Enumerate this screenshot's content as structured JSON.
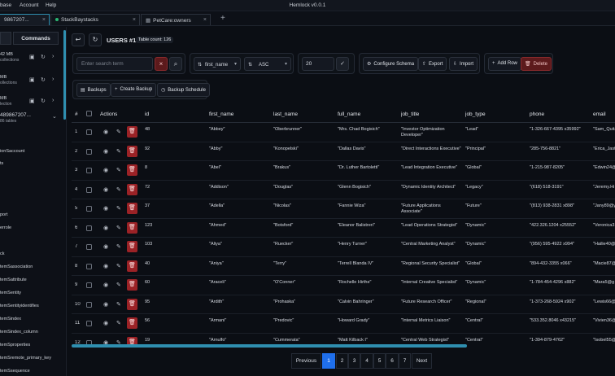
{
  "menubar": {
    "items": [
      "base",
      "Account",
      "Help"
    ],
    "title": "Hemlock v0.0.1"
  },
  "tabs": [
    {
      "label": "9867207..."
    },
    {
      "label": "StackBaystacks"
    },
    {
      "label": "PetCare:owners"
    }
  ],
  "sidebar": {
    "commands_label": "Commands",
    "connections": [
      {
        "size": "42 MB",
        "sub": "collections"
      },
      {
        "size": "MB",
        "sub": "ollections"
      },
      {
        "size": "MB",
        "sub": "lection"
      }
    ],
    "database": {
      "name": "489867207...",
      "sub": "86 tables"
    },
    "tables": [
      "ionSaccount",
      "ts",
      "",
      "",
      "",
      "port",
      "errole",
      "",
      "ck",
      "temSassociation",
      "temSattribute",
      "temSentity",
      "temSentityidentifies",
      "temSindex",
      "temSindex_column",
      "temSproperties",
      "temSremote_primary_key",
      "temSsequence"
    ]
  },
  "header": {
    "title": "USERS #1",
    "count": "Table count: 126"
  },
  "toolbar": {
    "search_placeholder": "Enter search term",
    "sort_field": "first_name",
    "sort_order": "ASC",
    "limit": "20",
    "schema_label": "Configure Schema",
    "export_label": "Export",
    "import_label": "Import",
    "add_row_label": "Add Row",
    "delete_label": "Delete"
  },
  "toolbar2": {
    "backups_label": "Backups",
    "create_backup_label": "Create Backup",
    "schedule_label": "Backup Schedule"
  },
  "table": {
    "columns": [
      "#",
      "Actions",
      "id",
      "first_name",
      "last_name",
      "full_name",
      "job_title",
      "job_type",
      "phone",
      "email"
    ],
    "rows": [
      [
        "1",
        "48",
        "\"Abbey\"",
        "\"Oberbrunner\"",
        "\"Mrs. Chad Bogisich\"",
        "\"Investor Optimization Developer\"",
        "\"Lead\"",
        "\"1-326-667-4395 x35992\"",
        "\"Sam_Quitz"
      ],
      [
        "2",
        "92",
        "\"Abby\"",
        "\"Konopelski\"",
        "\"Dallas Davis\"",
        "\"Direct Interactions Executive\"",
        "\"Principal\"",
        "\"285-756-8821\"",
        "\"Erica_Jast"
      ],
      [
        "3",
        "8",
        "\"Abel\"",
        "\"Brakus\"",
        "\"Dr. Luther Bartoletti\"",
        "\"Lead Integration Executive\"",
        "\"Global\"",
        "\"1-215-987-8205\"",
        "\"Edwin24@"
      ],
      [
        "4",
        "72",
        "\"Addison\"",
        "\"Douglas\"",
        "\"Glenn Bogisich\"",
        "\"Dynamic Identity Architect\"",
        "\"Legacy\"",
        "\"(618) 518-3191\"",
        "\"Jeremy.Hi"
      ],
      [
        "5",
        "37",
        "\"Adella\"",
        "\"Nicolas\"",
        "\"Fannie Wiza\"",
        "\"Future Applications Associate\"",
        "\"Future\"",
        "\"(813) 938-2831 x898\"",
        "\"Jany89@y"
      ],
      [
        "6",
        "123",
        "\"Ahmed\"",
        "\"Botsford\"",
        "\"Eleanor Balistreri\"",
        "\"Lead Operations Strategist\"",
        "\"Dynamic\"",
        "\"422.326.1204 x25552\"",
        "\"Veronica3"
      ],
      [
        "7",
        "103",
        "\"Aliya\"",
        "\"Ruecker\"",
        "\"Henry Turner\"",
        "\"Central Marketing Analyst\"",
        "\"Dynamic\"",
        "\"(956) 595-4922 x994\"",
        "\"Hailie40@"
      ],
      [
        "8",
        "40",
        "\"Aniya\"",
        "\"Terry\"",
        "\"Terrell Blanda IV\"",
        "\"Regional Security Specialist\"",
        "\"Global\"",
        "\"894-432-3355 x066\"",
        "\"Macie87@"
      ],
      [
        "9",
        "60",
        "\"Araceli\"",
        "\"O'Conner\"",
        "\"Rochelle Hirthe\"",
        "\"Internal Creative Specialist\"",
        "\"Dynamic\"",
        "\"1-784-454-4296 x882\"",
        "\"Mara5@g"
      ],
      [
        "10",
        "95",
        "\"Ardith\"",
        "\"Prohaska\"",
        "\"Calvin Bahringer\"",
        "\"Future Research Officer\"",
        "\"Regional\"",
        "\"1-373-268-5924 x902\"",
        "\"Lewis66@"
      ],
      [
        "11",
        "56",
        "\"Armani\"",
        "\"Predovic\"",
        "\"Howard Grady\"",
        "\"Internal Metrics Liaison\"",
        "\"Central\"",
        "\"533.352.8046 x43215\"",
        "\"Vivien36@"
      ],
      [
        "12",
        "19",
        "\"Arnulfo\"",
        "\"Cummerata\"",
        "\"Matt Kilback I\"",
        "\"Central Web Strategist\"",
        "\"Central\"",
        "\"1-394-879-4762\"",
        "\"Isobel55@"
      ]
    ]
  },
  "pagination": {
    "prev": "Previous",
    "pages": [
      "1",
      "2",
      "3",
      "4",
      "5",
      "6",
      "7"
    ],
    "next": "Next",
    "current": "1"
  },
  "colors": {
    "accent": "#2f8fb0",
    "danger": "#9b2226",
    "active_page": "#1f6feb"
  }
}
